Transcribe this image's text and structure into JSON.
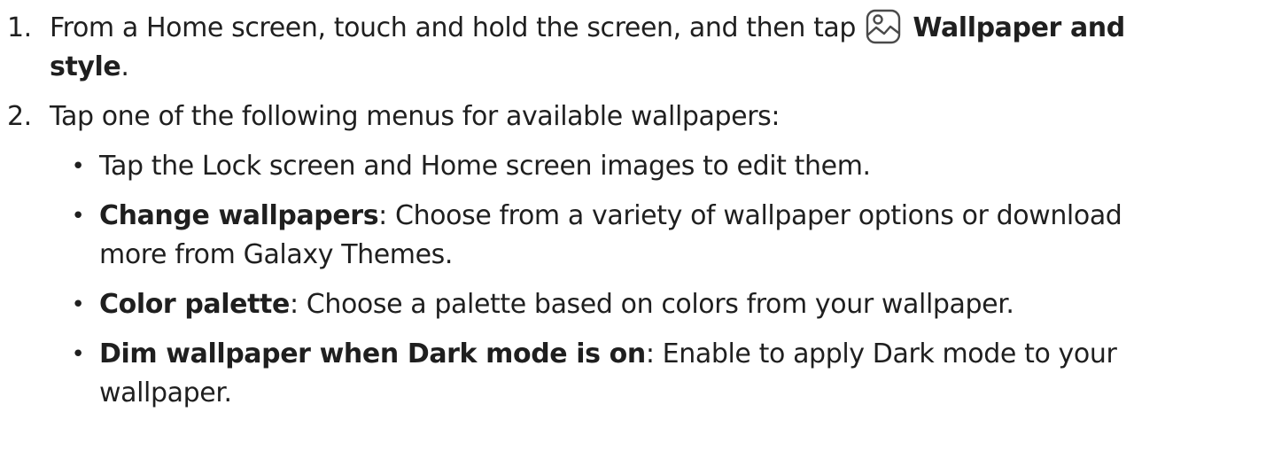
{
  "steps": [
    {
      "number": "1.",
      "text_before": "From a Home screen, touch and hold the screen, and then tap",
      "icon": "wallpaper-image-icon",
      "bold": "Wallpaper and",
      "bold_line2": "style",
      "text_after": "."
    },
    {
      "number": "2.",
      "text": "Tap one of the following menus for available wallpapers:"
    }
  ],
  "bullets": [
    {
      "text_line1": "Tap the Lock screen and Home screen images to edit them."
    },
    {
      "bold": "Change wallpapers",
      "text_line1": ": Choose from a variety of wallpaper options or download",
      "text_line2": "more from Galaxy Themes."
    },
    {
      "bold": "Color palette",
      "text_line1": ": Choose a palette based on colors from your wallpaper."
    },
    {
      "bold": "Dim wallpaper when Dark mode is on",
      "text_line1": ": Enable to apply Dark mode to your",
      "text_line2": "wallpaper."
    }
  ],
  "bullet_glyph": "•"
}
